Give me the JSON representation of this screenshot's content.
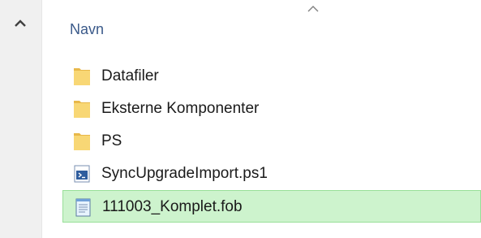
{
  "column_header": {
    "name_label": "Navn"
  },
  "files": [
    {
      "name": "Datafiler",
      "type": "folder",
      "icon": "folder-icon",
      "selected": false
    },
    {
      "name": "Eksterne Komponenter",
      "type": "folder",
      "icon": "folder-icon",
      "selected": false
    },
    {
      "name": "PS",
      "type": "folder",
      "icon": "folder-icon",
      "selected": false
    },
    {
      "name": "SyncUpgradeImport.ps1",
      "type": "powershell-script",
      "icon": "powershell-script-icon",
      "selected": false
    },
    {
      "name": "111003_Komplet.fob",
      "type": "fob-file",
      "icon": "notepad-file-icon",
      "selected": true
    }
  ],
  "colors": {
    "selection_fill": "#cdf3cd",
    "selection_border": "#99df99",
    "header_text": "#3b5a8a",
    "folder_yellow": "#f8d775"
  }
}
